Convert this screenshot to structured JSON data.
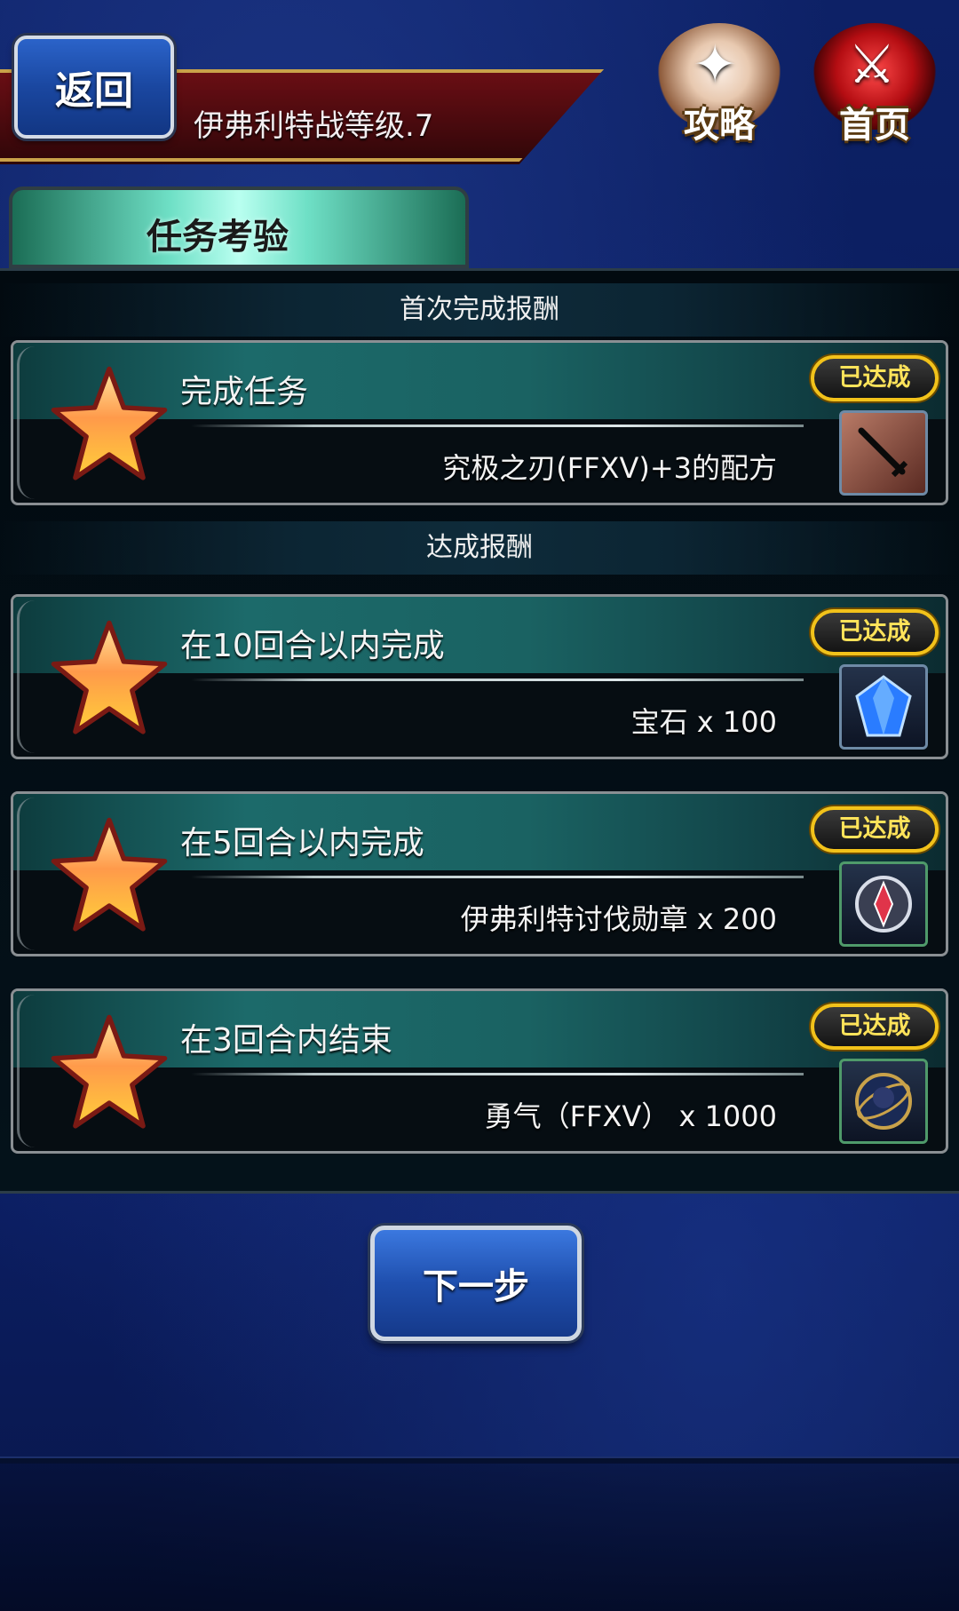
{
  "header": {
    "back_label": "返回",
    "stage_title": "伊弗利特战等级.7",
    "guide_label": "攻略",
    "home_label": "首页"
  },
  "tab": {
    "label": "任务考验"
  },
  "sections": {
    "first_clear": "首次完成报酬",
    "achievement": "达成报酬"
  },
  "missions": [
    {
      "title": "完成任务",
      "reward": "究极之刃(FFXV)+3的配方",
      "status": "已达成",
      "icon": "recipe-icon"
    },
    {
      "title": "在10回合以内完成",
      "reward": "宝石 x 100",
      "status": "已达成",
      "icon": "gem-icon"
    },
    {
      "title": "在5回合以内完成",
      "reward": "伊弗利特讨伐勋章 x 200",
      "status": "已达成",
      "icon": "medal-icon"
    },
    {
      "title": "在3回合内结束",
      "reward": "勇气（FFXV） x 1000",
      "status": "已达成",
      "icon": "character-token-icon"
    }
  ],
  "footer": {
    "next_label": "下一步"
  },
  "colors": {
    "background": "#0c1f66",
    "mission_band": "#1c6a6a",
    "badge_border": "#f2c21a",
    "badge_text": "#ffe35a",
    "title_bar": "#6a0e14"
  }
}
